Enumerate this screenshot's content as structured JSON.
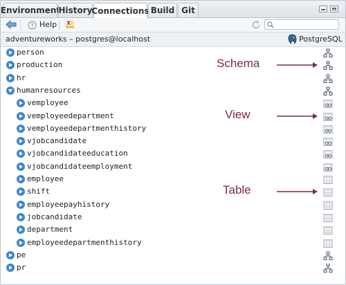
{
  "tabs": [
    {
      "label": "Environment",
      "active": false
    },
    {
      "label": "History",
      "active": false
    },
    {
      "label": "Connections",
      "active": true
    },
    {
      "label": "Build",
      "active": false
    },
    {
      "label": "Git",
      "active": false
    }
  ],
  "toolbar": {
    "help_label": "Help",
    "search_placeholder": ""
  },
  "connection": {
    "title": "adventureworks – postgres@localhost",
    "type": "PostgreSQL"
  },
  "tree": [
    {
      "label": "person",
      "kind": "schema",
      "level": 0,
      "expanded": false
    },
    {
      "label": "production",
      "kind": "schema",
      "level": 0,
      "expanded": false
    },
    {
      "label": "hr",
      "kind": "schema",
      "level": 0,
      "expanded": false
    },
    {
      "label": "humanresources",
      "kind": "schema",
      "level": 0,
      "expanded": true
    },
    {
      "label": "vemployee",
      "kind": "view",
      "level": 1,
      "expanded": false
    },
    {
      "label": "vemployeedepartment",
      "kind": "view",
      "level": 1,
      "expanded": false
    },
    {
      "label": "vemployeedepartmenthistory",
      "kind": "view",
      "level": 1,
      "expanded": false
    },
    {
      "label": "vjobcandidate",
      "kind": "view",
      "level": 1,
      "expanded": false
    },
    {
      "label": "vjobcandidateeducation",
      "kind": "view",
      "level": 1,
      "expanded": false
    },
    {
      "label": "vjobcandidateemployment",
      "kind": "view",
      "level": 1,
      "expanded": false
    },
    {
      "label": "employee",
      "kind": "table",
      "level": 1,
      "expanded": false
    },
    {
      "label": "shift",
      "kind": "table",
      "level": 1,
      "expanded": false
    },
    {
      "label": "employeepayhistory",
      "kind": "table",
      "level": 1,
      "expanded": false
    },
    {
      "label": "jobcandidate",
      "kind": "table",
      "level": 1,
      "expanded": false
    },
    {
      "label": "department",
      "kind": "table",
      "level": 1,
      "expanded": false
    },
    {
      "label": "employeedepartmenthistory",
      "kind": "table",
      "level": 1,
      "expanded": false
    },
    {
      "label": "pe",
      "kind": "schema",
      "level": 0,
      "expanded": false
    },
    {
      "label": "pr",
      "kind": "schema",
      "level": 0,
      "expanded": false
    }
  ],
  "annotations": [
    {
      "label": "Schema",
      "row": 1
    },
    {
      "label": "View",
      "row": 5
    },
    {
      "label": "Table",
      "row": 11
    }
  ],
  "colors": {
    "annotation": "#7a2a46",
    "expander": "#3f86c9",
    "accent": "#3f86c9"
  }
}
